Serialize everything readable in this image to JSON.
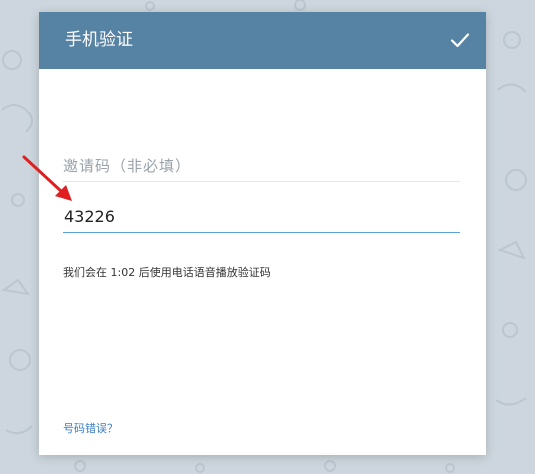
{
  "dialog": {
    "title": "手机验证",
    "confirm_icon": "check-icon"
  },
  "form": {
    "invite_placeholder": "邀请码（非必填）",
    "code_value": "43226",
    "hint": "我们会在 1:02 后使用电话语音播放验证码",
    "wrong_number_link": "号码错误？"
  },
  "colors": {
    "header": "#5682a3",
    "background": "#cdd6de",
    "active_underline": "#5da0dc",
    "link": "#3b7fc4",
    "annotation_arrow": "#e02020"
  }
}
